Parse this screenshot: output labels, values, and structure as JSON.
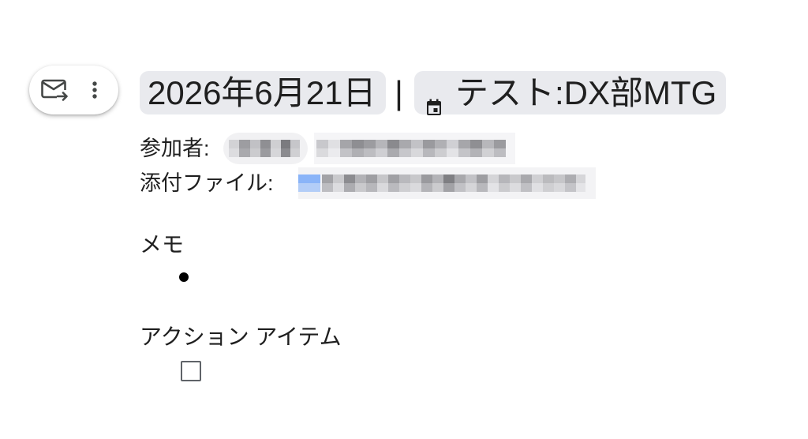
{
  "toolbar": {
    "email_icon": "email-draft-icon",
    "more_icon": "more-vert-icon"
  },
  "header": {
    "date_label": "2026年6月21日",
    "separator": "|",
    "event_icon": "calendar-event-icon",
    "event_title": "テスト:DX部MTG"
  },
  "attendees": {
    "label": "参加者:"
  },
  "attachments": {
    "label": "添付ファイル:"
  },
  "notes": {
    "heading": "メモ"
  },
  "action_items": {
    "heading": "アクション アイテム"
  },
  "colors": {
    "chip_background": "#e9eaee",
    "text": "#1f1f1f",
    "attachment_icon": "#8ab4f8"
  }
}
